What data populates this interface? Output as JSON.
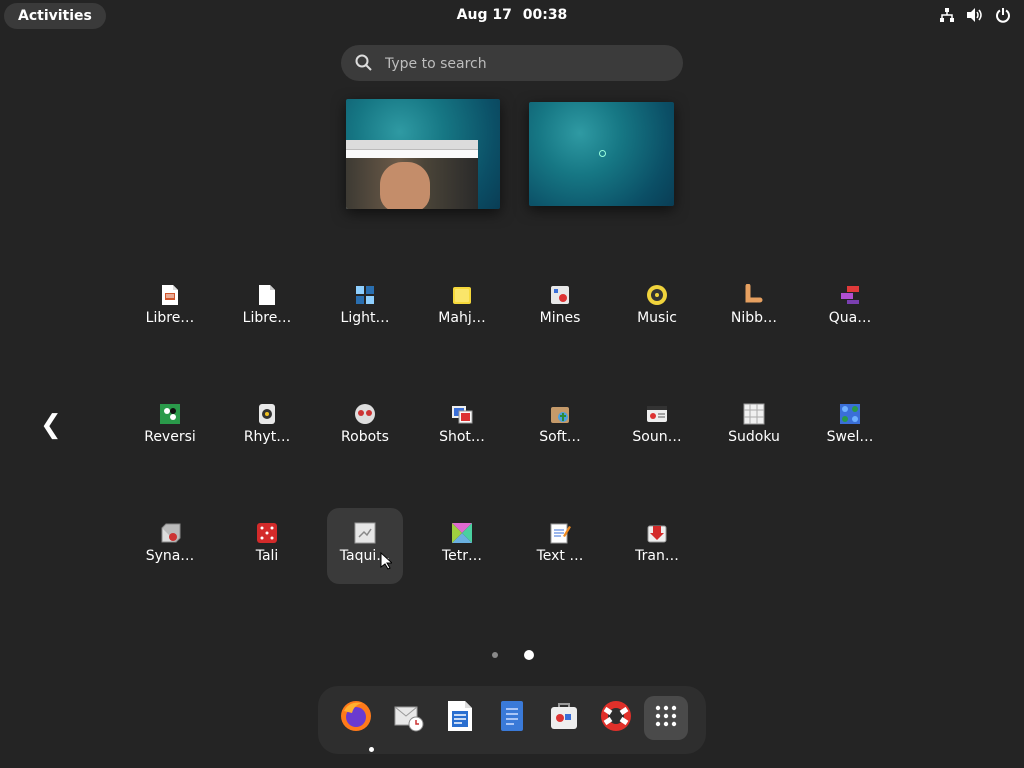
{
  "topbar": {
    "activities": "Activities",
    "date": "Aug 17",
    "time": "00:38",
    "status_icons": [
      "network-icon",
      "volume-icon",
      "power-icon"
    ]
  },
  "search": {
    "placeholder": "Type to search"
  },
  "workspaces": [
    "workspace-1",
    "workspace-2"
  ],
  "app_grid": {
    "rows": [
      [
        {
          "label": "Libre…",
          "icon": "libreoffice-impress-icon"
        },
        {
          "label": "Libre…",
          "icon": "libreoffice-startcenter-icon"
        },
        {
          "label": "Light…",
          "icon": "lightsoff-icon"
        },
        {
          "label": "Mahj…",
          "icon": "mahjongg-icon"
        },
        {
          "label": "Mines",
          "icon": "mines-icon"
        },
        {
          "label": "Music",
          "icon": "music-icon"
        },
        {
          "label": "Nibb…",
          "icon": "nibbles-icon"
        },
        {
          "label": "Qua…",
          "icon": "quadrapassel-icon"
        }
      ],
      [
        {
          "label": "Reversi",
          "icon": "reversi-icon"
        },
        {
          "label": "Rhyt…",
          "icon": "rhythmbox-icon"
        },
        {
          "label": "Robots",
          "icon": "robots-icon"
        },
        {
          "label": "Shot…",
          "icon": "shotwell-icon"
        },
        {
          "label": "Soft…",
          "icon": "software-icon"
        },
        {
          "label": "Soun…",
          "icon": "sound-recorder-icon"
        },
        {
          "label": "Sudoku",
          "icon": "sudoku-icon"
        },
        {
          "label": "Swel…",
          "icon": "swell-foop-icon"
        }
      ],
      [
        {
          "label": "Syna…",
          "icon": "synaptic-icon"
        },
        {
          "label": "Tali",
          "icon": "tali-icon"
        },
        {
          "label": "Taqui…",
          "icon": "taquin-icon"
        },
        {
          "label": "Tetr…",
          "icon": "tetravex-icon"
        },
        {
          "label": "Text …",
          "icon": "text-editor-icon"
        },
        {
          "label": "Tran…",
          "icon": "transmission-icon"
        }
      ]
    ],
    "hovered": "Taqui…"
  },
  "pager": {
    "pages": 2,
    "current": 2
  },
  "dash": {
    "items": [
      "firefox-icon",
      "evolution-icon",
      "libreoffice-writer-icon",
      "text-document-icon",
      "software-store-icon",
      "help-icon",
      "show-apps-icon"
    ]
  },
  "colors": {
    "background": "#242424",
    "panel": "#3a3a3a",
    "accent_teal": "#167784"
  }
}
